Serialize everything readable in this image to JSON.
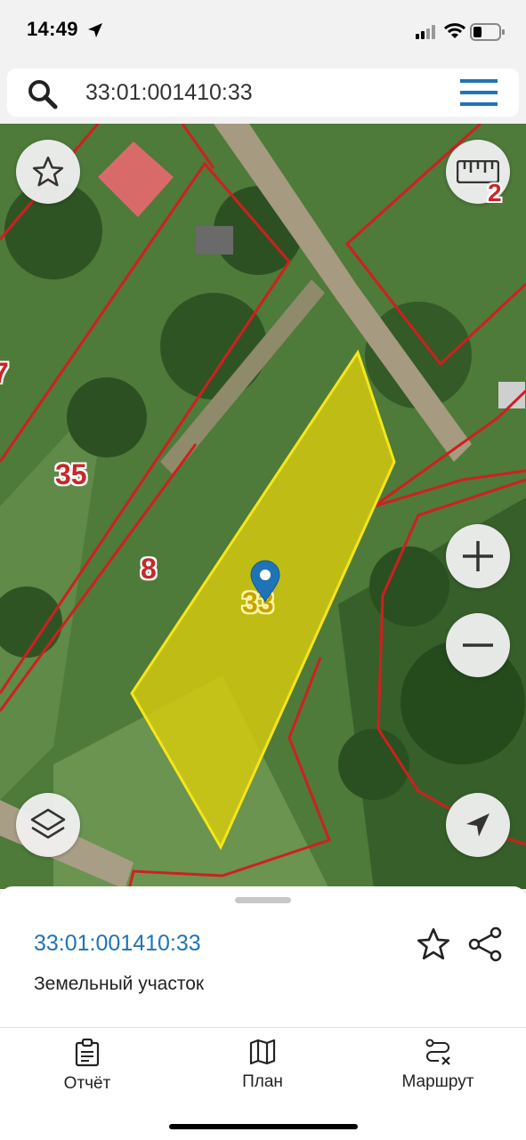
{
  "status_bar": {
    "time": "14:49"
  },
  "search": {
    "query": "33:01:001410:33"
  },
  "map": {
    "parcel_labels": [
      "2",
      "7",
      "35",
      "8",
      "33"
    ]
  },
  "sheet": {
    "title": "33:01:001410:33",
    "subtitle": "Земельный участок"
  },
  "tabs": [
    {
      "label": "Отчёт",
      "icon": "clipboard-icon"
    },
    {
      "label": "План",
      "icon": "map-icon"
    },
    {
      "label": "Маршрут",
      "icon": "route-icon"
    }
  ],
  "colors": {
    "accent": "#1f73b7",
    "parcel_border": "#d01f1f",
    "selected_fill": "#d4c90f",
    "selected_border": "#f5e61a"
  }
}
